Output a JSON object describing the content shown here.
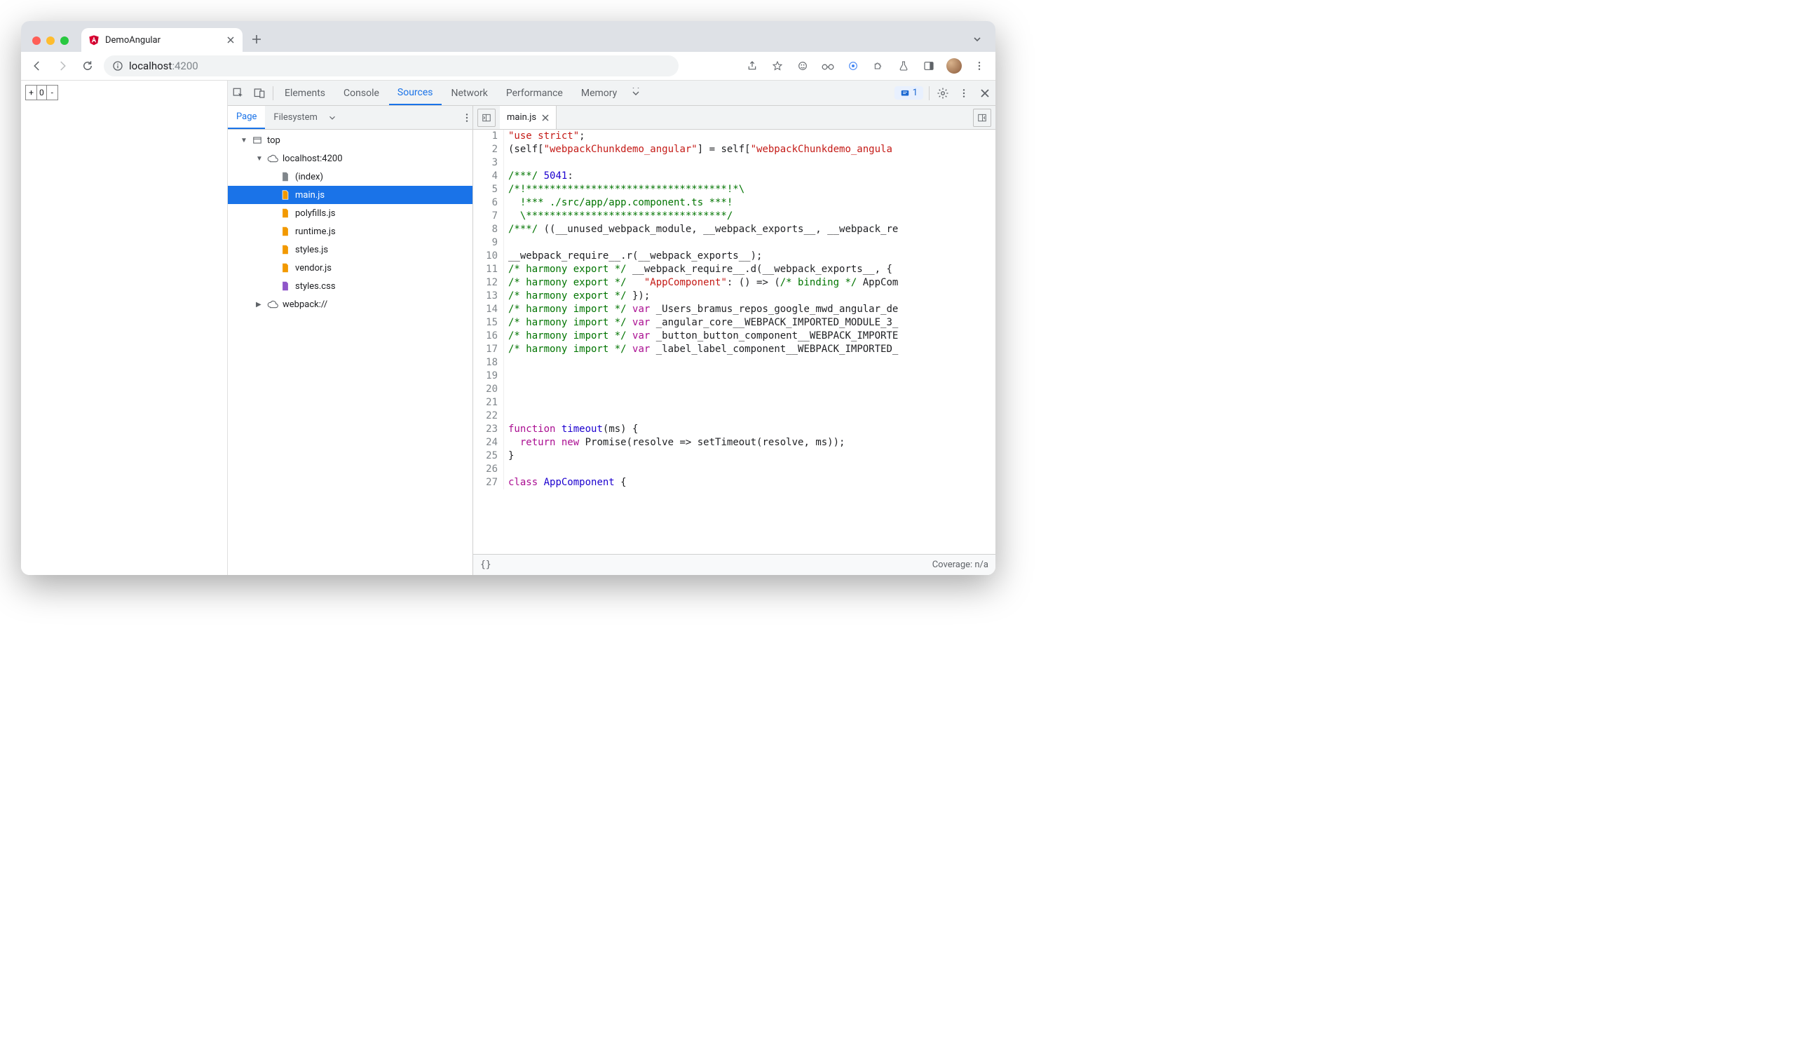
{
  "browser": {
    "tab_title": "DemoAngular",
    "url_host": "localhost",
    "url_port_path": ":4200"
  },
  "page": {
    "counter_minus": "-",
    "counter_plus": "+",
    "counter_value": "0"
  },
  "devtools": {
    "panels": [
      "Elements",
      "Console",
      "Sources",
      "Network",
      "Performance",
      "Memory"
    ],
    "active_panel": "Sources",
    "issues_count": "1",
    "navigator": {
      "subtabs": [
        "Page",
        "Filesystem"
      ],
      "active_subtab": "Page",
      "tree": {
        "top": "top",
        "origin": "localhost:4200",
        "files": [
          "(index)",
          "main.js",
          "polyfills.js",
          "runtime.js",
          "styles.js",
          "vendor.js",
          "styles.css"
        ],
        "selected": "main.js",
        "webpack": "webpack://"
      }
    },
    "editor": {
      "open_file": "main.js",
      "status_left": "{}",
      "status_right": "Coverage: n/a",
      "lines": [
        {
          "n": 1,
          "html": "<span class='c-str'>\"use strict\"</span>;"
        },
        {
          "n": 2,
          "html": "(self[<span class='c-str'>\"webpackChunkdemo_angular\"</span>] = self[<span class='c-str'>\"webpackChunkdemo_angula</span>"
        },
        {
          "n": 3,
          "html": ""
        },
        {
          "n": 4,
          "html": "<span class='c-com'>/***/</span> <span class='c-lit'>5041</span>:"
        },
        {
          "n": 5,
          "html": "<span class='c-com'>/*!**********************************!*\\</span>"
        },
        {
          "n": 6,
          "html": "<span class='c-com'>  !*** ./src/app/app.component.ts ***!</span>"
        },
        {
          "n": 7,
          "html": "<span class='c-com'>  \\**********************************/</span>"
        },
        {
          "n": 8,
          "html": "<span class='c-com'>/***/</span> ((__unused_webpack_module, __webpack_exports__, __webpack_re"
        },
        {
          "n": 9,
          "html": ""
        },
        {
          "n": 10,
          "html": "__webpack_require__.r(__webpack_exports__);"
        },
        {
          "n": 11,
          "html": "<span class='c-com'>/* harmony export */</span> __webpack_require__.d(__webpack_exports__, {"
        },
        {
          "n": 12,
          "html": "<span class='c-com'>/* harmony export */</span>   <span class='c-str'>\"AppComponent\"</span>: () =&gt; (<span class='c-com'>/* binding */</span> AppCom"
        },
        {
          "n": 13,
          "html": "<span class='c-com'>/* harmony export */</span> });"
        },
        {
          "n": 14,
          "html": "<span class='c-com'>/* harmony import */</span> <span class='c-kw'>var</span> _Users_bramus_repos_google_mwd_angular_de"
        },
        {
          "n": 15,
          "html": "<span class='c-com'>/* harmony import */</span> <span class='c-kw'>var</span> _angular_core__WEBPACK_IMPORTED_MODULE_3_"
        },
        {
          "n": 16,
          "html": "<span class='c-com'>/* harmony import */</span> <span class='c-kw'>var</span> _button_button_component__WEBPACK_IMPORTE"
        },
        {
          "n": 17,
          "html": "<span class='c-com'>/* harmony import */</span> <span class='c-kw'>var</span> _label_label_component__WEBPACK_IMPORTED_"
        },
        {
          "n": 18,
          "html": ""
        },
        {
          "n": 19,
          "html": ""
        },
        {
          "n": 20,
          "html": ""
        },
        {
          "n": 21,
          "html": ""
        },
        {
          "n": 22,
          "html": ""
        },
        {
          "n": 23,
          "html": "<span class='c-kw'>function</span> <span class='c-fn'>timeout</span>(ms) {"
        },
        {
          "n": 24,
          "html": "  <span class='c-kw'>return</span> <span class='c-kw'>new</span> Promise(resolve =&gt; setTimeout(resolve, ms));"
        },
        {
          "n": 25,
          "html": "}"
        },
        {
          "n": 26,
          "html": ""
        },
        {
          "n": 27,
          "html": "<span class='c-kw'>class</span> <span class='c-fn'>AppComponent</span> {"
        }
      ]
    }
  }
}
